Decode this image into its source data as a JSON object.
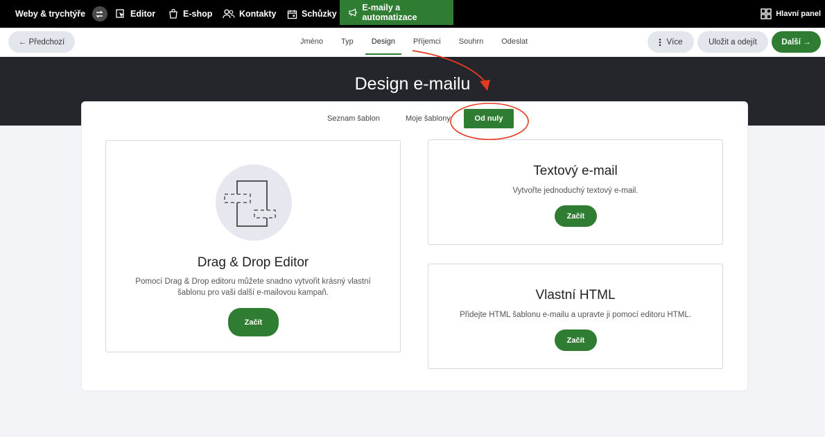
{
  "topnav": {
    "brand": "Weby & trychtýře",
    "items": [
      {
        "label": "Editor",
        "icon": "editor-icon"
      },
      {
        "label": "E-shop",
        "icon": "shopping-bag-icon"
      },
      {
        "label": "Kontakty",
        "icon": "contacts-icon"
      },
      {
        "label": "Schůzky",
        "icon": "calendar-icon"
      },
      {
        "label": "E-maily a automatizace",
        "icon": "megaphone-icon"
      }
    ],
    "active_item": "E-maily a automatizace",
    "dashboard": "Hlavní panel"
  },
  "subbar": {
    "prev": "← Předchozí",
    "steps": [
      "Jméno",
      "Typ",
      "Design",
      "Příjemci",
      "Souhrn",
      "Odeslat"
    ],
    "active_step": "Design",
    "more": "Více",
    "save_exit": "Uložit a odejít",
    "next": "Další →"
  },
  "page": {
    "title": "Design e-mailu"
  },
  "tabs": {
    "list": "Seznam šablon",
    "mine": "Moje šablony",
    "scratch": "Od nuly",
    "active": "Od nuly"
  },
  "cards": {
    "dnd": {
      "title": "Drag & Drop Editor",
      "desc_line1": "Pomocí Drag & Drop editoru můžete snadno vytvořit krásný vlastní",
      "desc_line2": "šablonu pro vaši další e-mailovou kampaň.",
      "button": "Začít"
    },
    "text": {
      "title": "Textový e-mail",
      "desc": "Vytvořte jednoduchý textový e-mail.",
      "button": "Začít"
    },
    "html": {
      "title": "Vlastní HTML",
      "desc": "Přidejte HTML šablonu e-mailu a upravte ji pomocí editoru HTML.",
      "button": "Začít"
    }
  },
  "colors": {
    "accent": "#2e7d32",
    "annotation": "#e53a1f",
    "header_bg": "#24262c"
  }
}
